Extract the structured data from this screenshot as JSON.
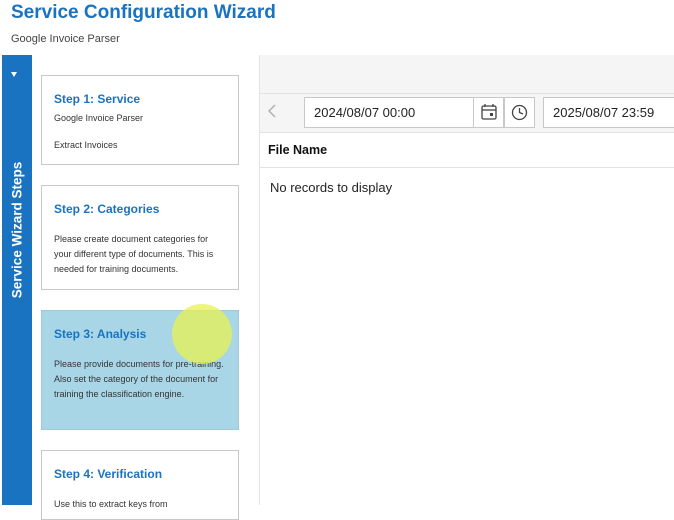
{
  "header": {
    "title": "Service Configuration Wizard",
    "subtitle": "Google Invoice Parser"
  },
  "wizard_tab": {
    "label": "Service Wizard Steps"
  },
  "steps": [
    {
      "title": "Step 1: Service",
      "desc_line1": "Google Invoice Parser",
      "desc_line2": "Extract Invoices"
    },
    {
      "title": "Step 2: Categories",
      "description": "Please create document categories for your different type of documents. This is needed for training documents."
    },
    {
      "title": "Step 3: Analysis",
      "description": "Please provide documents for pre-training. Also set the category of the document for training the classification engine.",
      "active": true
    },
    {
      "title": "Step 4: Verification",
      "description": "Use this to extract keys from"
    }
  ],
  "filter": {
    "start_datetime": "2024/08/07 00:00",
    "end_datetime": "2025/08/07 23:59"
  },
  "grid": {
    "columns": [
      "File Name"
    ],
    "empty_message": "No records to display"
  },
  "colors": {
    "accent": "#1a73c0",
    "active_step_bg": "#a8d6e6"
  },
  "icons": [
    "chevron-left-icon",
    "calendar-icon",
    "clock-icon",
    "chevron-down-icon"
  ]
}
